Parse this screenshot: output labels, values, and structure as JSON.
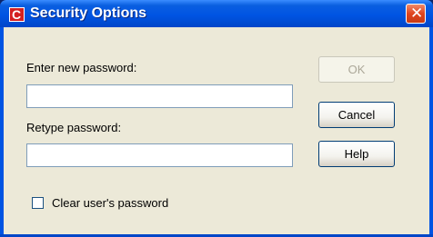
{
  "dialog": {
    "title": "Security Options",
    "app_icon_letter": "C",
    "close_glyph": "✕"
  },
  "form": {
    "new_password_label": "Enter new password:",
    "new_password_value": "",
    "retype_password_label": "Retype password:",
    "retype_password_value": "",
    "clear_password_label": "Clear user's password",
    "clear_password_checked": false
  },
  "buttons": {
    "ok_label": "OK",
    "ok_enabled": false,
    "cancel_label": "Cancel",
    "help_label": "Help"
  },
  "colors": {
    "titlebar": "#0054e3",
    "dialog_bg": "#ece9d8",
    "close_button": "#e0451e",
    "app_icon": "#d42020"
  }
}
